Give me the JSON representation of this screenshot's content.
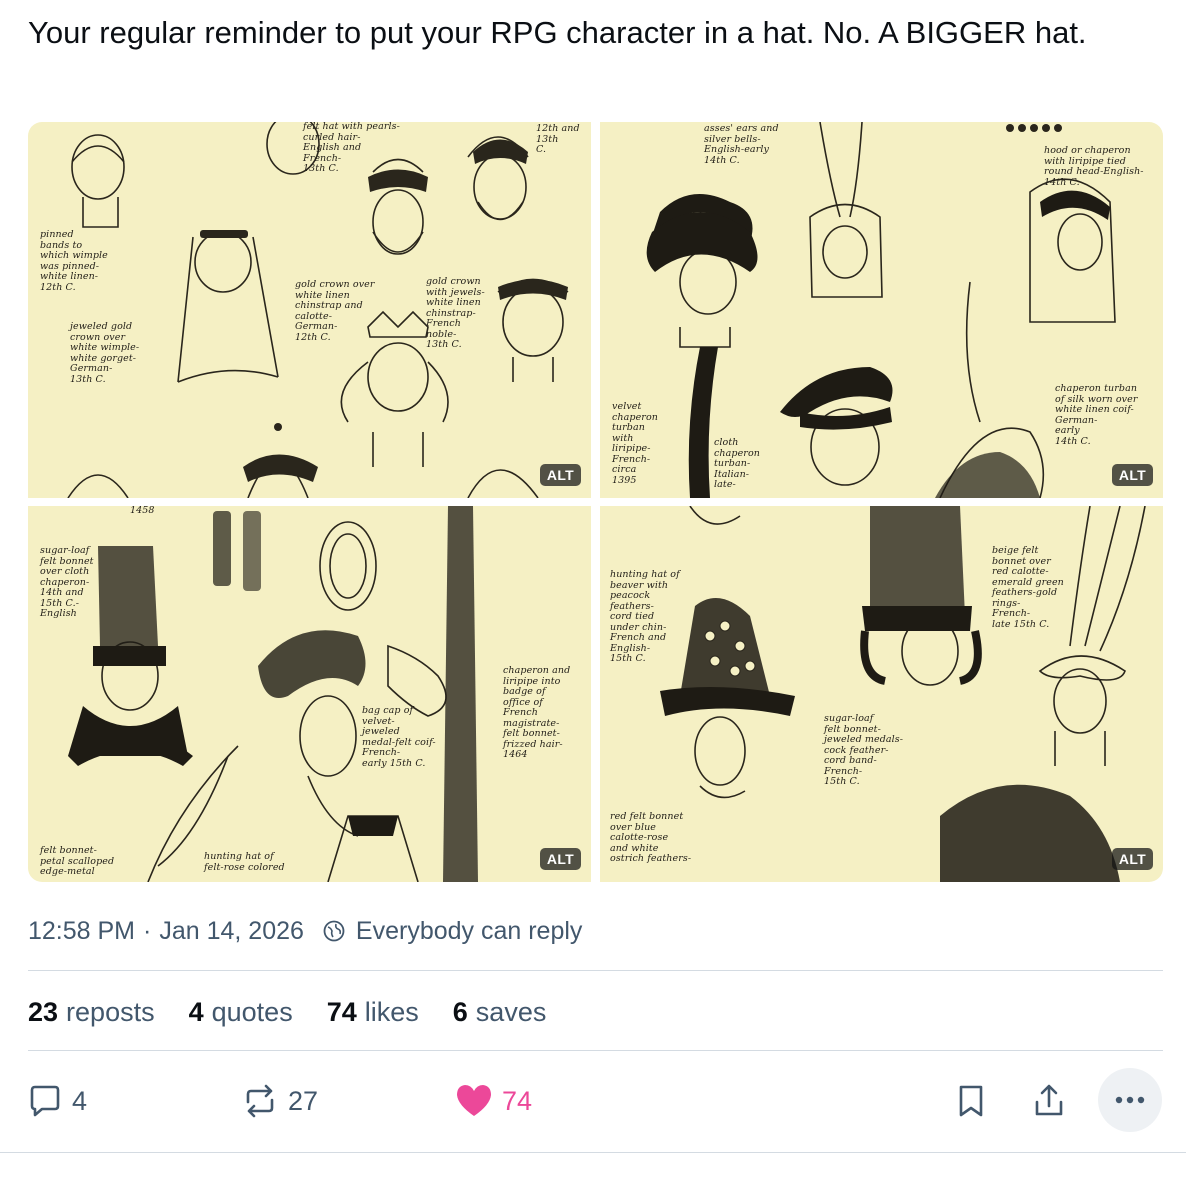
{
  "post": {
    "text": "Your regular reminder to put your RPG character in a hat. No. A BIGGER hat."
  },
  "images": [
    {
      "alt_label": "ALT",
      "captions": [
        "felt hat with pearls-\ncurled hair-\nEnglish and\nFrench-\n13th C.",
        "12th and\n13th\nC.",
        "pinned\nbands to\nwhich wimple\nwas pinned-\nwhite linen-\n12th C.",
        "gold crown over\nwhite linen\nchinstrap and\ncalotte-\nGerman-\n12th C.",
        "gold crown\nwith jewels-\nwhite linen\nchinstrap-\nFrench\nnoble-\n13th C.",
        "jeweled gold\ncrown over\nwhite wimple-\nwhite gorget-\nGerman-\n13th C."
      ]
    },
    {
      "alt_label": "ALT",
      "captions": [
        "asses' ears and\nsilver bells-\nEnglish-early\n14th C.",
        "hood or chaperon\nwith liripipe tied\nround head-English-\n14th C.",
        "velvet\nchaperon\nturban\nwith\nliripipe-\nFrench-\ncirca\n1395",
        "cloth\nchaperon\nturban-\nItalian-\nlate-",
        "chaperon turban\nof silk worn over\nwhite linen coif-\nGerman-\nearly\n14th C."
      ]
    },
    {
      "alt_label": "ALT",
      "captions": [
        "1458",
        "sugar-loaf\nfelt bonnet\nover cloth\nchaperon-\n14th and\n15th C.-\nEnglish",
        "bag cap of\nvelvet-\njeweled\nmedal-felt coif-\nFrench-\nearly 15th C.",
        "chaperon and\nliripipe into\nbadge of\noffice of\nFrench\nmagistrate-\nfelt bonnet-\nfrizzed hair-\n1464",
        "felt bonnet-\npetal scalloped\nedge-metal",
        "hunting hat of\nfelt-rose colored"
      ]
    },
    {
      "alt_label": "ALT",
      "captions": [
        "hunting hat of\nbeaver with\npeacock\nfeathers-\ncord tied\nunder chin-\nFrench and\nEnglish-\n15th C.",
        "beige felt\nbonnet over\nred calotte-\nemerald green\nfeathers-gold\nrings-\nFrench-\nlate 15th C.",
        "sugar-loaf\nfelt bonnet-\njeweled medals-\ncock feather-\ncord band-\nFrench-\n15th C.",
        "red felt bonnet\nover blue\ncalotte-rose\nand white\nostrich feathers-"
      ]
    }
  ],
  "meta": {
    "time": "12:58 PM",
    "separator": "·",
    "date": "Jan 14, 2026",
    "reply_setting": "Everybody can reply"
  },
  "stats": {
    "reposts_count": "23",
    "reposts_label": "reposts",
    "quotes_count": "4",
    "quotes_label": "quotes",
    "likes_count": "74",
    "likes_label": "likes",
    "saves_count": "6",
    "saves_label": "saves"
  },
  "actions": {
    "reply_count": "4",
    "repost_count": "27",
    "like_count": "74"
  },
  "colors": {
    "text": "#0b0f14",
    "muted": "#42576c",
    "like_pink": "#ec4899",
    "parchment": "#f5f0c4",
    "divider": "#d4dbe2"
  },
  "icons": [
    "reply-icon",
    "repost-icon",
    "heart-icon",
    "bookmark-icon",
    "share-icon",
    "more-icon",
    "globe-icon"
  ]
}
